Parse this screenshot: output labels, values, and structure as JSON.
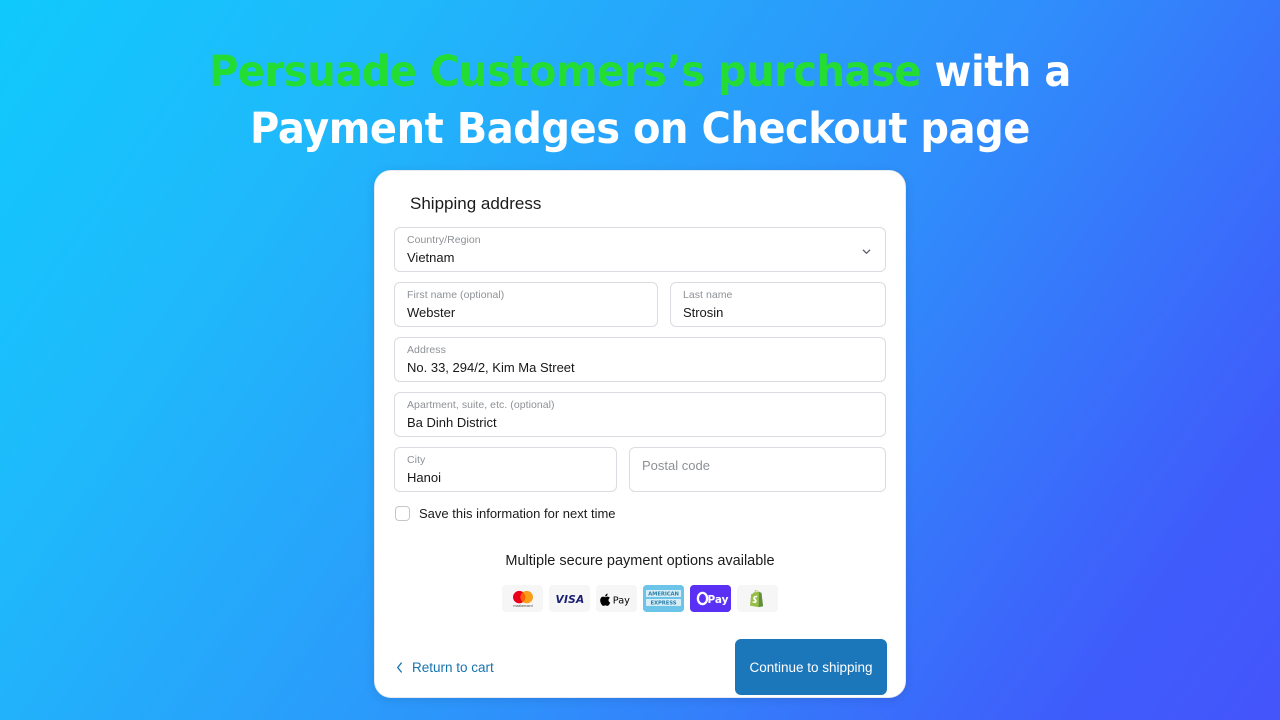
{
  "headline": {
    "accent_text": "Persuade Customers’s purchase",
    "rest_line1": " with a",
    "line2": "Payment Badges on Checkout page",
    "accent_color": "#23dd33",
    "text_color": "#ffffff"
  },
  "background": {
    "gradient_from": "#10c9fc",
    "gradient_to": "#4455fb"
  },
  "checkout": {
    "title": "Shipping address",
    "fields": {
      "country": {
        "label": "Country/Region",
        "value": "Vietnam",
        "placeholder": ""
      },
      "first_name": {
        "label": "First name (optional)",
        "value": "Webster",
        "placeholder": ""
      },
      "last_name": {
        "label": "Last name",
        "value": "Strosin",
        "placeholder": ""
      },
      "address": {
        "label": "Address",
        "value": "No. 33, 294/2, Kim Ma Street",
        "placeholder": ""
      },
      "apartment": {
        "label": "Apartment, suite, etc. (optional)",
        "value": "Ba Dinh District",
        "placeholder": ""
      },
      "city": {
        "label": "City",
        "value": "Hanoi",
        "placeholder": ""
      },
      "postal_code": {
        "label": "",
        "value": "",
        "placeholder": "Postal code"
      }
    },
    "save_checkbox": {
      "label": "Save this information for next time",
      "checked": false
    },
    "payments": {
      "heading": "Multiple secure payment options available",
      "badges": [
        {
          "name": "mastercard-badge",
          "label": "mastercard"
        },
        {
          "name": "visa-badge",
          "label": "VISA"
        },
        {
          "name": "apple-pay-badge",
          "label": "Pay"
        },
        {
          "name": "american-express-badge",
          "label": "AMERICAN EXPRESS"
        },
        {
          "name": "shop-pay-badge",
          "label": "Pay"
        },
        {
          "name": "shopify-badge",
          "label": "Shopify"
        }
      ]
    },
    "footer": {
      "return_link": "Return to cart",
      "continue_button": "Continue to shipping",
      "button_color": "#1c76ba",
      "link_color": "#1773b0"
    }
  }
}
